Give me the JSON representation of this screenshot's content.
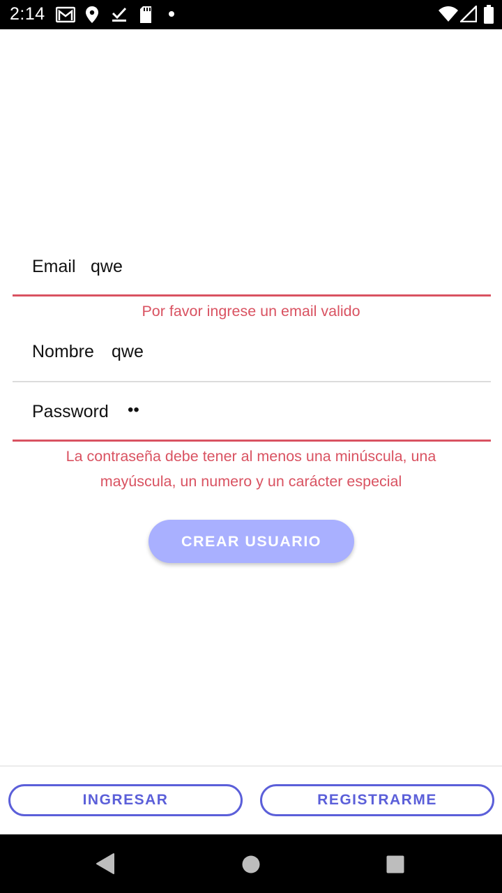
{
  "status_bar": {
    "time": "2:14",
    "icons": [
      "gmail-icon",
      "location-icon",
      "check-download-icon",
      "sd-card-icon",
      "dot-icon",
      "wifi-icon",
      "signal-icon",
      "battery-icon"
    ]
  },
  "form": {
    "email": {
      "label": "Email",
      "value": "qwe",
      "error": "Por favor ingrese un email valido"
    },
    "nombre": {
      "label": "Nombre",
      "value": "qwe"
    },
    "password": {
      "label": "Password",
      "value": "••",
      "error_line1": "La contraseña debe tener al menos una minúscula, una",
      "error_line2": "mayúscula, un numero y un carácter especial"
    },
    "submit_label": "CREAR USUARIO"
  },
  "bottom": {
    "login_label": "INGRESAR",
    "register_label": "REGISTRARME"
  },
  "colors": {
    "error": "#d95261",
    "primary_disabled": "#a9b0ff",
    "accent": "#5b5fd9"
  },
  "nav": {
    "back": "back-icon",
    "home": "home-icon",
    "recents": "recents-icon"
  }
}
